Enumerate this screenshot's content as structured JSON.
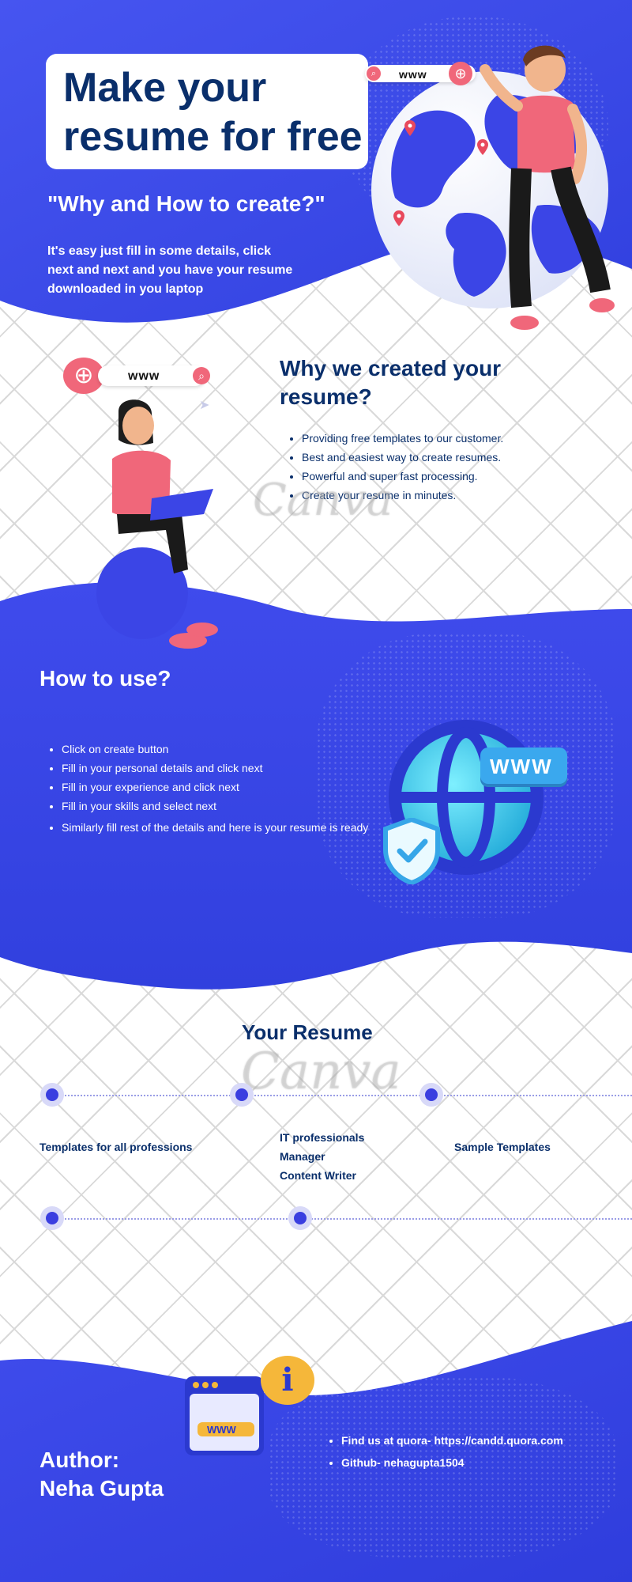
{
  "hero": {
    "title_line1": "Make your",
    "title_line2": "resume for free",
    "subtitle": "\"Why and How to create?\"",
    "intro": "It's easy just fill in some details, click next and next and you have your resume downloaded in you laptop"
  },
  "url_bar_text": "www",
  "why": {
    "heading": "Why we created your resume?",
    "items": [
      "Providing free templates to our customer.",
      "Best and easiest way to create resumes.",
      "Powerful and super fast processing.",
      "Create your resume in minutes."
    ]
  },
  "how": {
    "heading": "How to use?",
    "items": [
      "Click on create button",
      "Fill in your personal details and click next",
      "Fill in your experience and click next",
      "Fill in your skills and select next",
      "Similarly fill rest of the details and here is your resume is ready"
    ]
  },
  "www_badge": "WWW",
  "your_resume": {
    "heading": "Your Resume",
    "col1": "Templates for all professions",
    "col2": [
      "IT professionals",
      "Manager",
      "Content Writer"
    ],
    "col3": "Sample Templates"
  },
  "footer": {
    "author_label": "Author:",
    "author_name": "Neha Gupta",
    "links": [
      "Find us at quora- https://candd.quora.com",
      "Github- nehagupta1504"
    ],
    "window_url_text": "WWW"
  },
  "watermark_text": "Canva",
  "colors": {
    "primary_blue": "#3b45e6",
    "navy": "#0a2f6b",
    "pink": "#f0677a"
  }
}
